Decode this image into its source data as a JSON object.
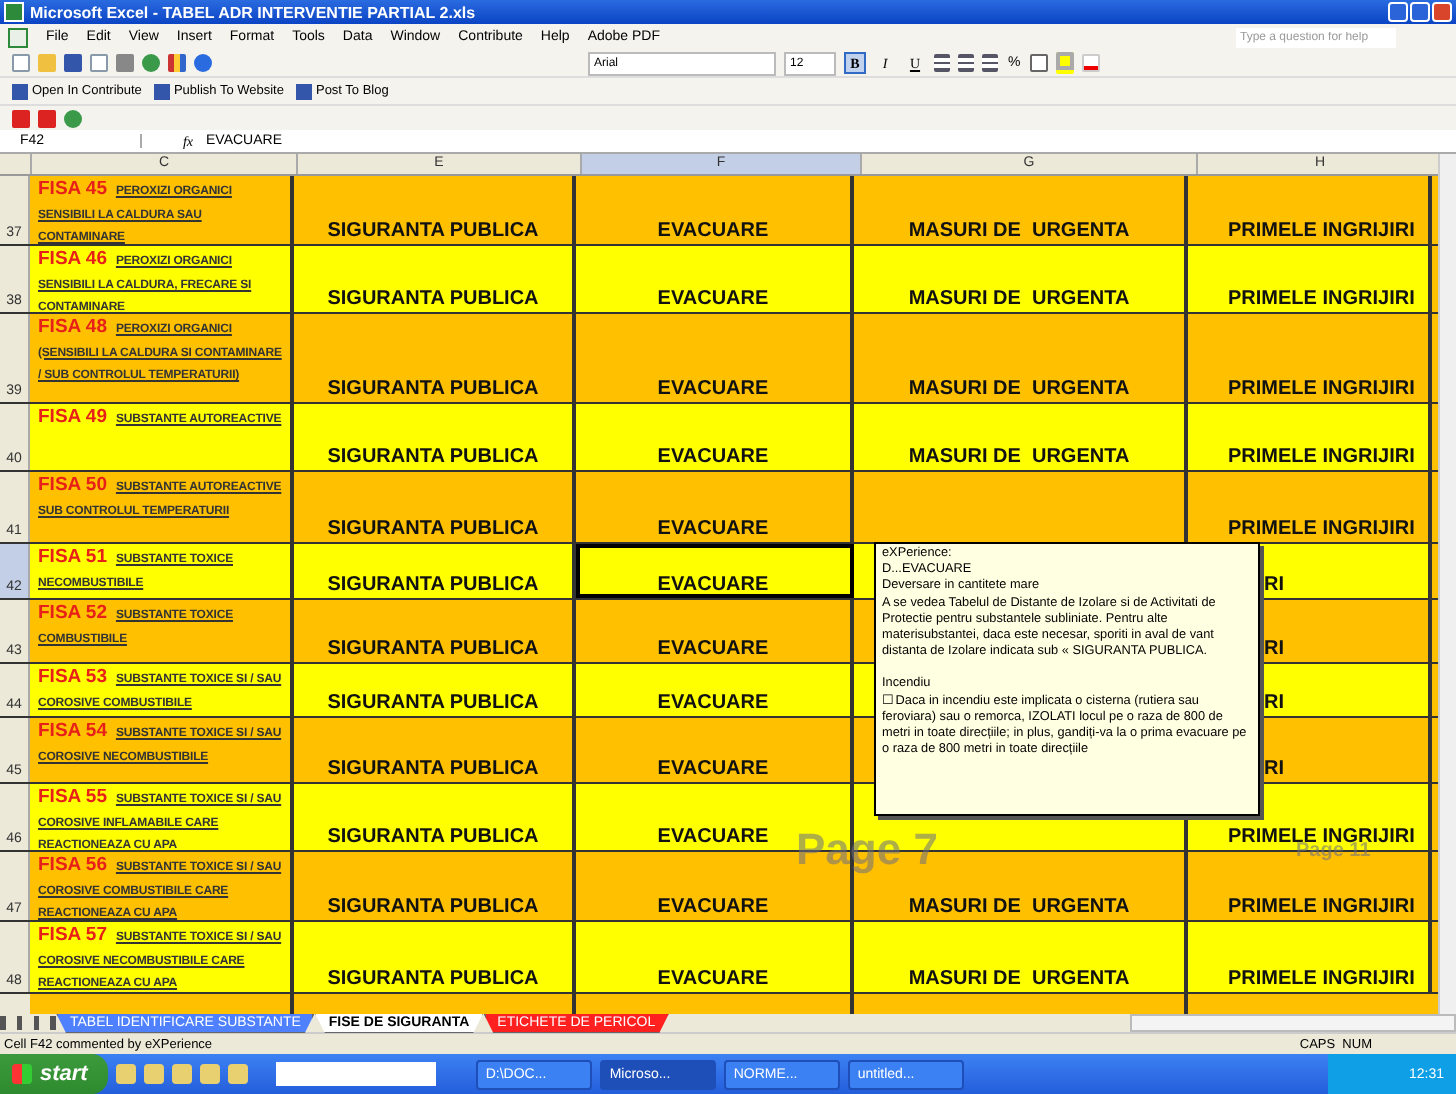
{
  "window": {
    "title": "Microsoft Excel - TABEL ADR INTERVENTIE PARTIAL 2.xls"
  },
  "menu": [
    "File",
    "Edit",
    "View",
    "Insert",
    "Format",
    "Tools",
    "Data",
    "Window",
    "Contribute",
    "Help",
    "Adobe PDF"
  ],
  "help_box": {
    "placeholder": "Type a question for help"
  },
  "format_toolbar": {
    "font": "Arial",
    "size": "12",
    "styles": [
      {
        "label": "B",
        "kind": "bold",
        "selected": true
      },
      {
        "label": "I",
        "kind": "italic",
        "selected": false
      },
      {
        "label": "U",
        "kind": "underline",
        "selected": false
      }
    ],
    "percent": "%"
  },
  "contribute_bar": [
    "Open In Contribute",
    "Publish To Website",
    "Post To Blog"
  ],
  "formula_bar": {
    "name_box": "F42",
    "fx": "fx",
    "value": "EVACUARE"
  },
  "columns": [
    {
      "label": "C",
      "selected": false
    },
    {
      "label": "E",
      "selected": false
    },
    {
      "label": "F",
      "selected": true
    },
    {
      "label": "G",
      "selected": false
    },
    {
      "label": "H",
      "selected": false
    }
  ],
  "rows": [
    {
      "num": "37",
      "color": "#ffc000",
      "selected": false,
      "fisa": "FISA 45",
      "desc": "PEROXIZI ORGANICI SENSIBILI LA CALDURA SAU CONTAMINARE",
      "e": "SIGURANTA PUBLICA",
      "f": "EVACUARE",
      "g": "MASURI DE  URGENTA",
      "h": "PRIMELE INGRIJIRI"
    },
    {
      "num": "38",
      "color": "#ffff00",
      "selected": false,
      "fisa": "FISA 46",
      "desc": "PEROXIZI ORGANICI SENSIBILI LA CALDURA, FRECARE SI CONTAMINARE",
      "e": "SIGURANTA PUBLICA",
      "f": "EVACUARE",
      "g": "MASURI DE  URGENTA",
      "h": "PRIMELE INGRIJIRI"
    },
    {
      "num": "39",
      "color": "#ffc000",
      "selected": false,
      "fisa": "FISA 48",
      "desc": "PEROXIZI ORGANICI (SENSIBILI LA CALDURA SI CONTAMINARE / SUB CONTROLUL TEMPERATURII)",
      "e": "SIGURANTA PUBLICA",
      "f": "EVACUARE",
      "g": "MASURI DE  URGENTA",
      "h": "PRIMELE INGRIJIRI"
    },
    {
      "num": "40",
      "color": "#ffff00",
      "selected": false,
      "fisa": "FISA 49",
      "desc": "SUBSTANTE AUTOREACTIVE",
      "e": "SIGURANTA PUBLICA",
      "f": "EVACUARE",
      "g": "MASURI DE  URGENTA",
      "h": "PRIMELE INGRIJIRI"
    },
    {
      "num": "41",
      "color": "#ffc000",
      "selected": false,
      "fisa": "FISA 50",
      "desc": "SUBSTANTE AUTOREACTIVE SUB CONTROLUL TEMPERATURII",
      "e": "SIGURANTA PUBLICA",
      "f": "EVACUARE",
      "h": "PRIMELE INGRIJIRI"
    },
    {
      "num": "42",
      "color": "#ffff00",
      "selected": true,
      "fisa": "FISA 51",
      "desc": "SUBSTANTE TOXICE NECOMBUSTIBILE",
      "e": "SIGURANTA PUBLICA",
      "f": "EVACUARE",
      "h": "RI"
    },
    {
      "num": "43",
      "color": "#ffc000",
      "selected": false,
      "fisa": "FISA 52",
      "desc": "SUBSTANTE TOXICE COMBUSTIBILE",
      "e": "SIGURANTA PUBLICA",
      "f": "EVACUARE",
      "h": "RI"
    },
    {
      "num": "44",
      "color": "#ffff00",
      "selected": false,
      "fisa": "FISA 53",
      "desc": "SUBSTANTE TOXICE SI / SAU COROSIVE COMBUSTIBILE",
      "e": "SIGURANTA PUBLICA",
      "f": "EVACUARE",
      "h": "RI"
    },
    {
      "num": "45",
      "color": "#ffc000",
      "selected": false,
      "fisa": "FISA 54",
      "desc": "SUBSTANTE TOXICE SI / SAU COROSIVE NECOMBUSTIBILE",
      "e": "SIGURANTA PUBLICA",
      "f": "EVACUARE",
      "h": "RI"
    },
    {
      "num": "46",
      "color": "#ffff00",
      "selected": false,
      "fisa": "FISA 55",
      "desc": "SUBSTANTE TOXICE SI / SAU COROSIVE INFLAMABILE CARE REACTIONEAZA CU APA",
      "e": "SIGURANTA PUBLICA",
      "f": "EVACUARE",
      "h": "PRIMELE INGRIJIRI"
    },
    {
      "num": "47",
      "color": "#ffc000",
      "selected": false,
      "fisa": "FISA 56",
      "desc": "SUBSTANTE TOXICE SI / SAU COROSIVE COMBUSTIBILE CARE REACTIONEAZA CU APA",
      "e": "SIGURANTA PUBLICA",
      "f": "EVACUARE",
      "g": "MASURI DE  URGENTA",
      "h": "PRIMELE INGRIJIRI"
    },
    {
      "num": "48",
      "color": "#ffff00",
      "selected": false,
      "fisa": "FISA 57",
      "desc": "SUBSTANTE TOXICE SI / SAU COROSIVE NECOMBUSTIBILE CARE REACTIONEAZA CU APA",
      "e": "SIGURANTA PUBLICA",
      "f": "EVACUARE",
      "g": "MASURI DE  URGENTA",
      "h": "PRIMELE INGRIJIRI"
    }
  ],
  "page_labels": [
    "Page 7",
    "Page 11"
  ],
  "comment": {
    "paragraphs": [
      [
        "eXPerience:",
        "D...EVACUARE",
        "Deversare in cantitete mare",
        "A se vedea Tabelul de Distante de Izolare si de Activitati de Protectie pentru substantele subliniate. Pentru alte materisubstantei, daca este necesar, sporiti in aval de vant distanta de Izolare indicata sub « SIGURANTA PUBLICA."
      ],
      [
        "Incendiu",
        "☐ Daca in incendiu este implicata o cisterna (rutiera sau feroviara) sau o remorca, IZOLATI locul pe o raza de 800 de metri in toate direcțiile; in plus, gandiți-va la o prima evacuare pe o raza de 800 metri in toate direcțiile"
      ]
    ]
  },
  "sheet_tabs": [
    {
      "label": "TABEL  IDENTIFICARE SUBSTANTE",
      "color": "#4f81ff",
      "selected": false
    },
    {
      "label": "FISE DE SIGURANTA",
      "color": "#ffffff",
      "selected": true
    },
    {
      "label": "ETICHETE DE PERICOL",
      "color": "#ff2020",
      "selected": false
    }
  ],
  "status_bar": {
    "message": "Cell F42 commented by eXPerience",
    "indicators": "CAPS  NUM"
  },
  "taskbar": {
    "start": "start",
    "tasks": [
      {
        "label": "D:\\DOC...",
        "selected": false
      },
      {
        "label": "Microso...",
        "selected": true
      },
      {
        "label": "NORME...",
        "selected": false
      },
      {
        "label": "untitled...",
        "selected": false
      }
    ],
    "clock": "12:31"
  }
}
